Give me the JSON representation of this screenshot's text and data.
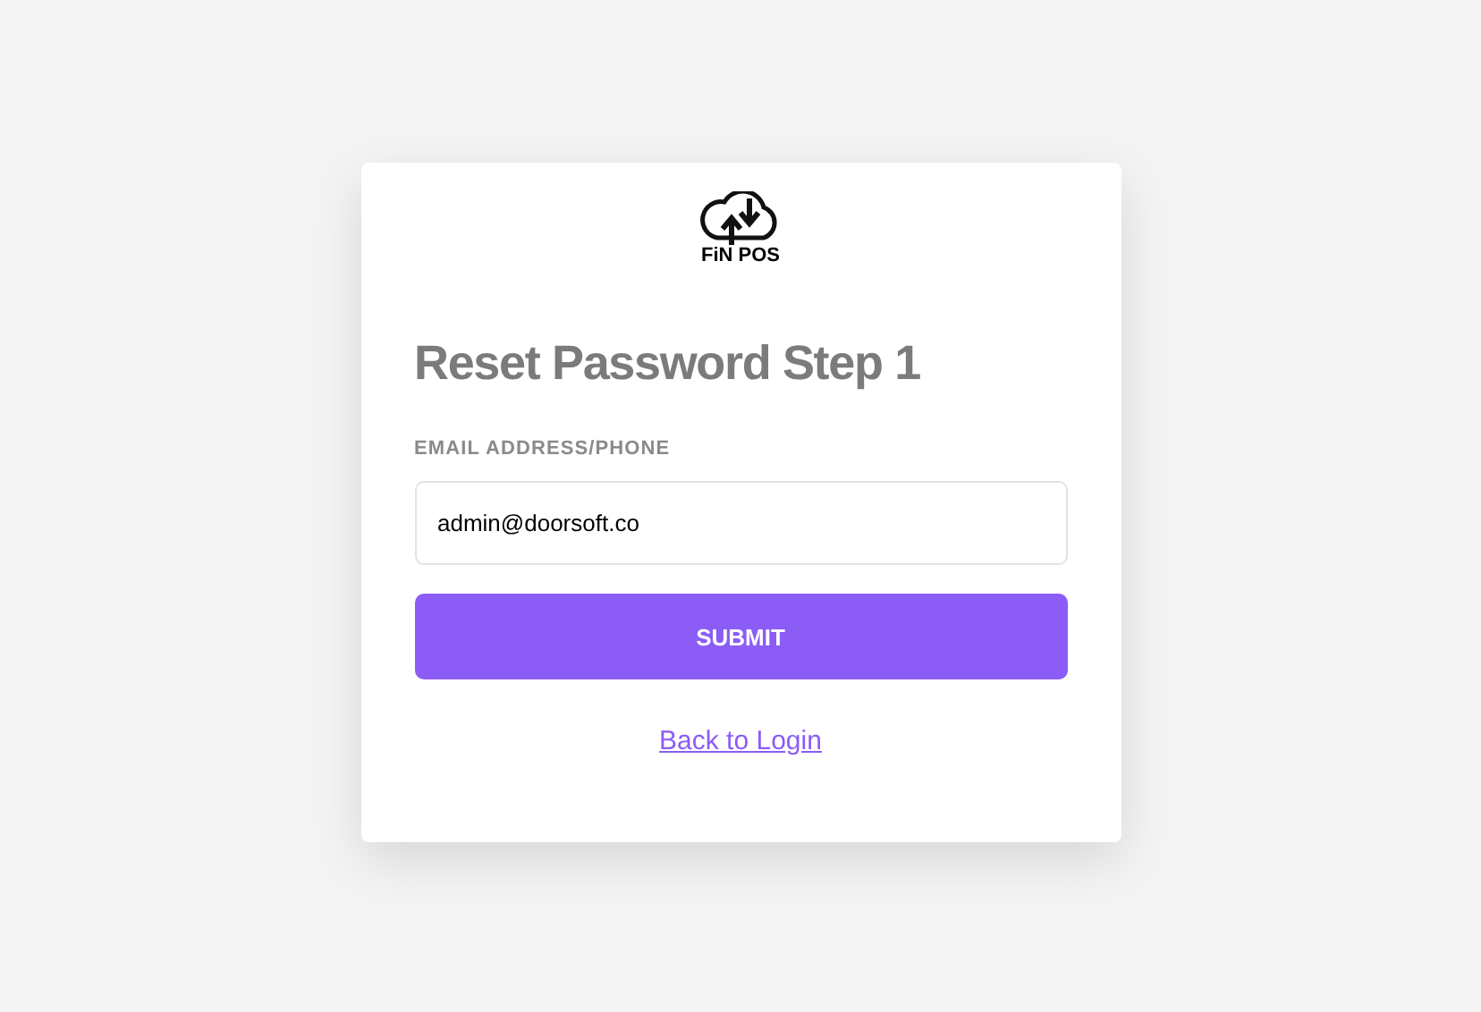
{
  "logo": {
    "text": "FiN POS"
  },
  "title": "Reset Password Step 1",
  "email_field": {
    "label": "EMAIL ADDRESS/PHONE",
    "value": "admin@doorsoft.co"
  },
  "submit_button": {
    "label": "SUBMIT"
  },
  "back_link": {
    "label": "Back to Login"
  }
}
